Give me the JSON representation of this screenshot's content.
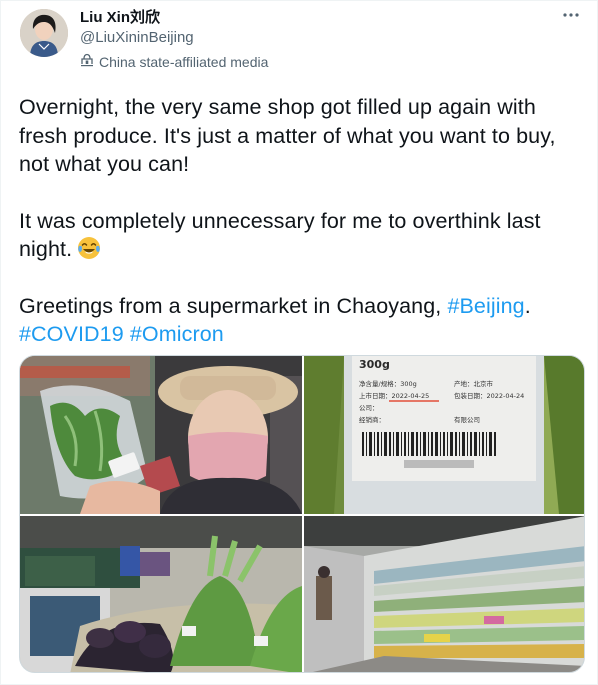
{
  "author": {
    "display_name": "Liu Xin刘欣",
    "handle": "@LiuXininBeijing",
    "affiliation": "China state-affiliated media"
  },
  "tweet": {
    "line1": "Overnight, the very same shop got filled up again with fresh produce. It's just a matter of what you want to buy,  not what you can!",
    "line2": "It was completely unnecessary for me to overthink last night.",
    "line3_prefix": "Greetings from a supermarket in Chaoyang, ",
    "hashtag_beijing": "#Beijing",
    "line3_suffix": ".",
    "hashtag_covid": "#COVID19",
    "hashtag_omicron": "#Omicron"
  },
  "label": {
    "weight": "300g",
    "origin_label": "产地：北京市",
    "date_on": "上市日期：2022-04-25",
    "date_pack": "包装日期：2022-04-24",
    "spec": "净含量/规格：300g",
    "company": "公司：",
    "distributor": "经销商：",
    "company_name": "有限公司"
  },
  "colors": {
    "link": "#1d9bf0",
    "secondary_text": "#536471"
  },
  "icons": {
    "more": "more-icon",
    "affiliation": "state-media-icon",
    "emoji": "tears-of-joy-emoji"
  }
}
